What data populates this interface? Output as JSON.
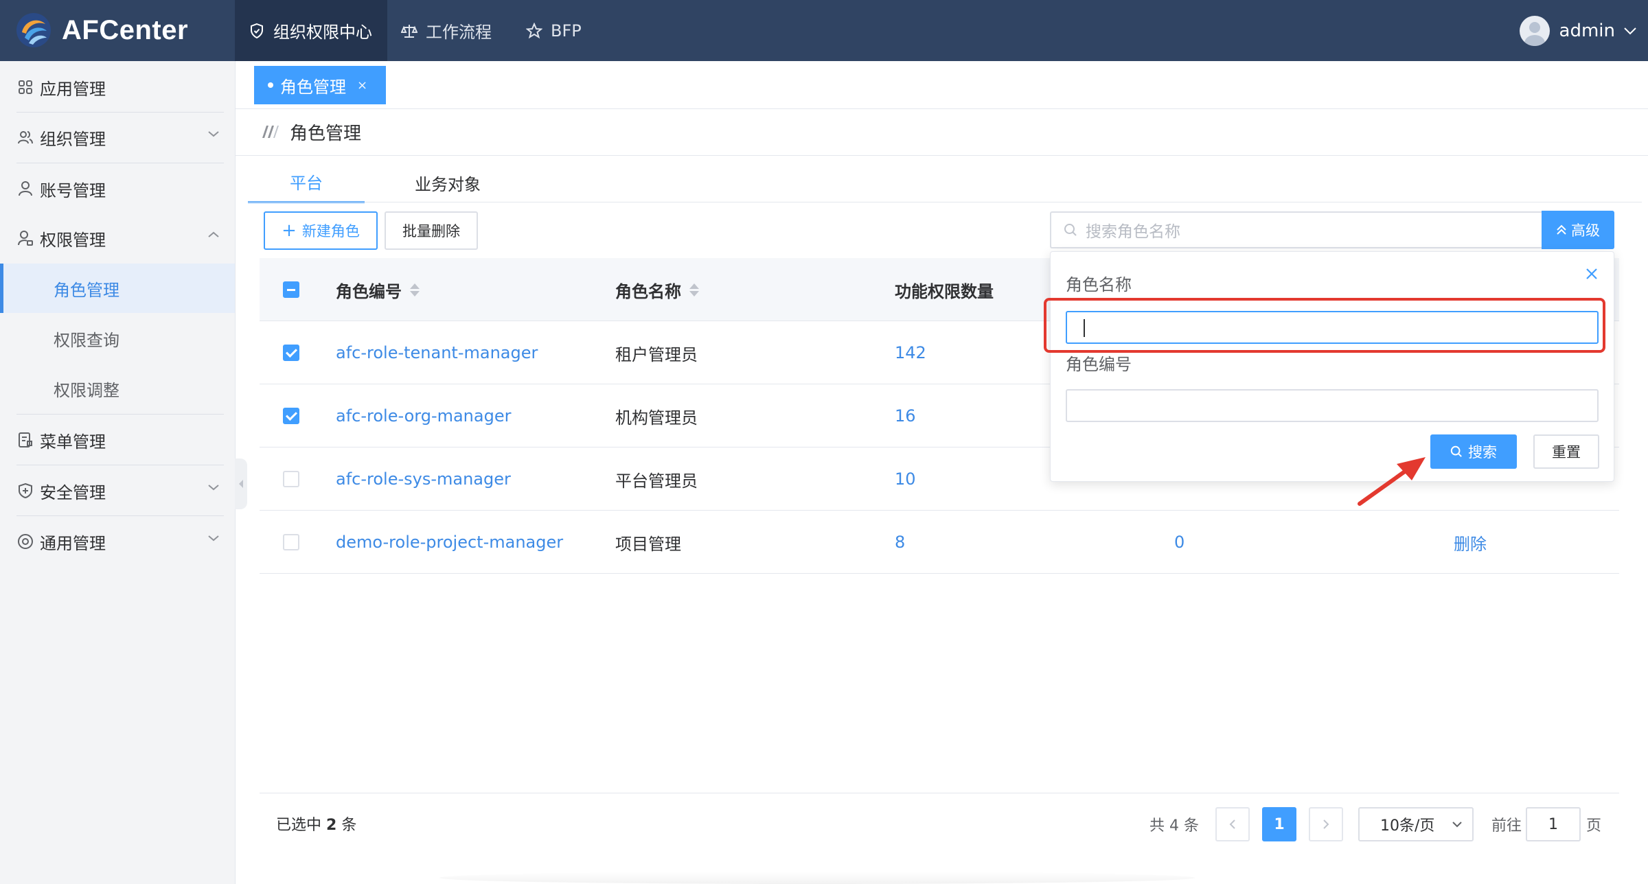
{
  "app": {
    "name": "AFCenter",
    "nav": {
      "org": "组织权限中心",
      "flow": "工作流程",
      "bfp": "BFP"
    },
    "user": "admin"
  },
  "sidebar": {
    "items": [
      {
        "label": "应用管理"
      },
      {
        "label": "组织管理"
      },
      {
        "label": "账号管理"
      },
      {
        "label": "权限管理"
      },
      {
        "label": "菜单管理"
      },
      {
        "label": "安全管理"
      },
      {
        "label": "通用管理"
      }
    ],
    "sub": [
      {
        "label": "角色管理"
      },
      {
        "label": "权限查询"
      },
      {
        "label": "权限调整"
      }
    ]
  },
  "tabs": {
    "page_tab": "角色管理",
    "close": "×"
  },
  "page": {
    "title": "角色管理",
    "subtabs": [
      "平台",
      "业务对象"
    ]
  },
  "toolbar": {
    "new_role": "新建角色",
    "batch_delete": "批量删除",
    "search_placeholder": "搜索角色名称",
    "advanced": "高级"
  },
  "table": {
    "headers": {
      "code": "角色编号",
      "name": "角色名称",
      "func_count": "功能权限数量"
    },
    "rows": [
      {
        "code": "afc-role-tenant-manager",
        "name": "租户管理员",
        "func": "142",
        "data": "",
        "op": "",
        "checked": true
      },
      {
        "code": "afc-role-org-manager",
        "name": "机构管理员",
        "func": "16",
        "data": "",
        "op": "",
        "checked": true
      },
      {
        "code": "afc-role-sys-manager",
        "name": "平台管理员",
        "func": "10",
        "data": "",
        "op": "",
        "checked": false
      },
      {
        "code": "demo-role-project-manager",
        "name": "项目管理",
        "func": "8",
        "data": "0",
        "op": "删除",
        "checked": false
      }
    ]
  },
  "footer": {
    "selected_prefix": "已选中",
    "selected_count": "2",
    "selected_suffix": "条",
    "total": "共 4 条",
    "current_page": "1",
    "page_size": "10条/页",
    "goto": "前往",
    "goto_value": "1",
    "page_word": "页"
  },
  "popover": {
    "label_name": "角色名称",
    "label_code": "角色编号",
    "search": "搜索",
    "reset": "重置"
  },
  "colors": {
    "nav_bg": "#304463",
    "primary": "#409eff",
    "highlight": "#e3392f"
  }
}
